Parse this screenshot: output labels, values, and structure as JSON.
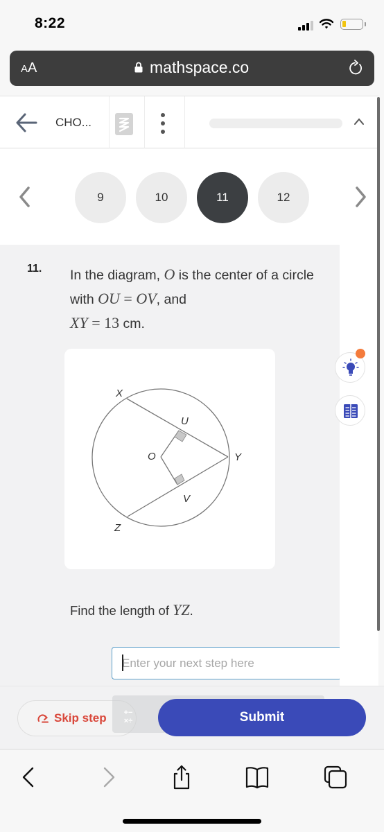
{
  "status_bar": {
    "time": "8:22",
    "signal_icon": "cellular-signal-icon",
    "wifi_icon": "wifi-icon",
    "battery_icon": "battery-low-icon",
    "battery_color": "#f1c40f"
  },
  "browser": {
    "text_size_label_small": "A",
    "text_size_label_large": "A",
    "url": "mathspace.co",
    "lock_icon": "lock-icon",
    "reload_icon": "reload-icon"
  },
  "app_header": {
    "back_icon": "arrow-left-icon",
    "course_title": "CHO...",
    "logo_icon": "mathspace-logo-icon",
    "more_icon": "more-vertical-icon",
    "collapse_icon": "chevron-up-icon"
  },
  "question_nav": {
    "prev_icon": "chevron-left-icon",
    "next_icon": "chevron-right-icon",
    "questions": [
      {
        "label": "9",
        "active": false
      },
      {
        "label": "10",
        "active": false
      },
      {
        "label": "11",
        "active": true
      },
      {
        "label": "12",
        "active": false
      }
    ]
  },
  "question": {
    "number": "11.",
    "intro_1": "In the diagram, ",
    "var_O": "O",
    "intro_2": " is the center of a circle with ",
    "eq_1": "OU",
    "eq_sign": " = ",
    "eq_2": "OV",
    "intro_3": ", and",
    "eq_3": "XY",
    "eq_4": "13",
    "unit": " cm.",
    "prompt_1": "Find the length of ",
    "prompt_var": "YZ",
    "prompt_2": "."
  },
  "diagram": {
    "labels": {
      "X": "X",
      "Y": "Y",
      "Z": "Z",
      "O": "O",
      "U": "U",
      "V": "V"
    },
    "right_angle_marks": [
      "U",
      "V"
    ]
  },
  "answer": {
    "placeholder": "Enter your next step here",
    "value": ""
  },
  "tools": {
    "hint_icon": "lightbulb-icon",
    "hint_badge_color": "#f47b3c",
    "book_icon": "worked-example-book-icon"
  },
  "actions": {
    "skip_label": "Skip step",
    "skip_icon": "skip-arrow-icon",
    "keypad_icon": "math-keypad-icon",
    "keypad_glyphs": "+−\n×÷",
    "submit_label": "Submit",
    "submit_color": "#3a4ab8",
    "skip_color": "#d9473a"
  },
  "safari_toolbar": {
    "back_icon": "back-chevron-icon",
    "forward_icon": "forward-chevron-icon",
    "share_icon": "share-icon",
    "bookmarks_icon": "bookmarks-book-icon",
    "tabs_icon": "tabs-icon"
  }
}
